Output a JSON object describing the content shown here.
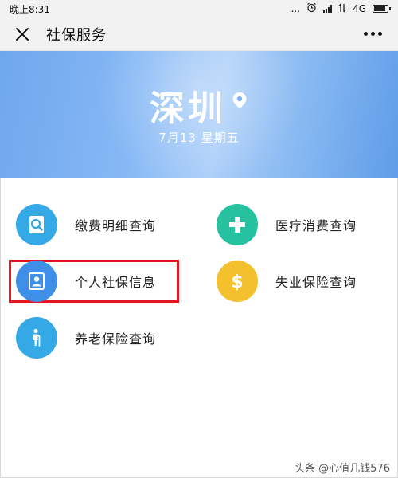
{
  "status_bar": {
    "time": "晚上8:31",
    "dots": "...",
    "network": "4G"
  },
  "nav": {
    "title": "社保服务",
    "close_icon": "close-icon",
    "more_icon": "more-icon"
  },
  "banner": {
    "city": "深圳",
    "date": "7月13  星期五"
  },
  "menu": [
    {
      "label": "缴费明细查询",
      "icon": "search-document-icon",
      "color": "#35a8e6"
    },
    {
      "label": "医疗消费查询",
      "icon": "medical-cross-icon",
      "color": "#26c2a0"
    },
    {
      "label": "个人社保信息",
      "icon": "id-card-icon",
      "color": "#3f8ee8"
    },
    {
      "label": "失业保险查询",
      "icon": "dollar-icon",
      "color": "#f4c02e"
    },
    {
      "label": "养老保险查询",
      "icon": "elderly-icon",
      "color": "#35a8e6"
    }
  ],
  "watermark": "头条 @心值几钱576"
}
